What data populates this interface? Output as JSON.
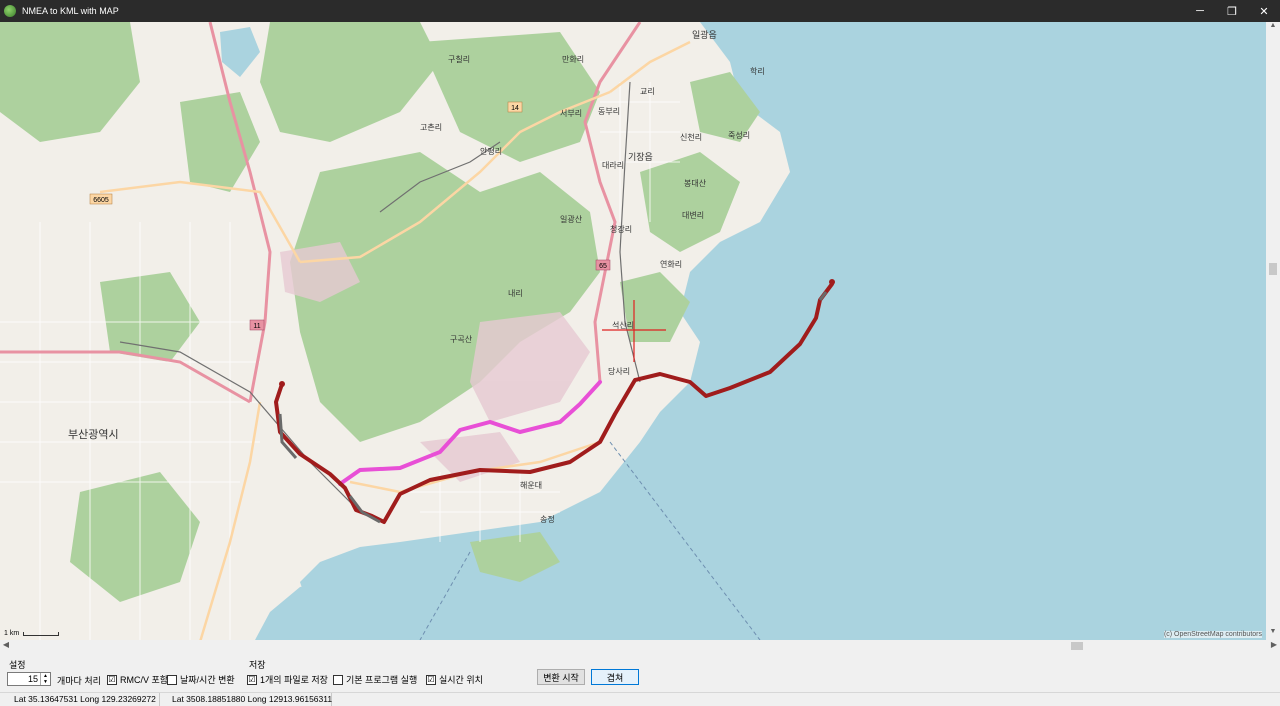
{
  "window": {
    "title": "NMEA to KML with MAP",
    "minimize_icon": "minimize-icon",
    "maximize_icon": "restore-icon",
    "close_icon": "close-icon"
  },
  "map": {
    "attribution": "(c) OpenStreetMap contributors",
    "scale_label": "1 km",
    "labels": {
      "city": "부산광역시",
      "gijang": "기장읍",
      "ilgwang": "일광읍",
      "seokgwari": "석산리",
      "dangsari": "당사리",
      "yeonhwari": "연화리",
      "daebyeonri": "대변리",
      "haksili": "학리",
      "mananri": "만화리",
      "guchilri": "구칠리",
      "gochonri": "고촌리",
      "anpyeongri": "안평리",
      "naeri": "내리",
      "sinchonri": "신천리",
      "jukseongri": "죽성리",
      "dongbuli": "동부리",
      "seobuli": "서부리",
      "daelari": "대라리",
      "cheongari": "청강리",
      "gyori": "교리",
      "ilgwangsan": "일광산",
      "gujisan": "구곡산",
      "bongdaesan": "봉대산",
      "road_14": "14",
      "road_65": "65",
      "road_11": "11",
      "road_6605": "6605",
      "haeundae": "해운대",
      "songjeong": "송정"
    }
  },
  "settings": {
    "group_label": "설정",
    "interval_value": "15",
    "interval_suffix": "개마다 처리",
    "rmcv_label": "RMC/V 포함",
    "rmcv_checked": "☑",
    "datetime_label": "날짜/시간 변환",
    "datetime_checked": ""
  },
  "save": {
    "group_label": "저장",
    "single_file_label": "1개의 파일로 저장",
    "single_file_checked": "☑",
    "default_program_label": "기본 프로그램 실행",
    "default_program_checked": "",
    "realtime_label": "실시간 위치",
    "realtime_checked": "☑"
  },
  "buttons": {
    "start_convert": "변환 시작",
    "overlay": "겹쳐"
  },
  "status": {
    "latlong": "Lat 35.13647531  Long 129.23269272",
    "raw": "Lat 3508.18851880  Long 12913.96156311"
  },
  "colors": {
    "sea": "#aad3df",
    "land": "#f2efe9",
    "forest": "#add19e",
    "track_red": "#a01c1c",
    "track_pink": "#e84fd6",
    "highway": "#e892a2",
    "primary_road": "#fcd6a4"
  }
}
